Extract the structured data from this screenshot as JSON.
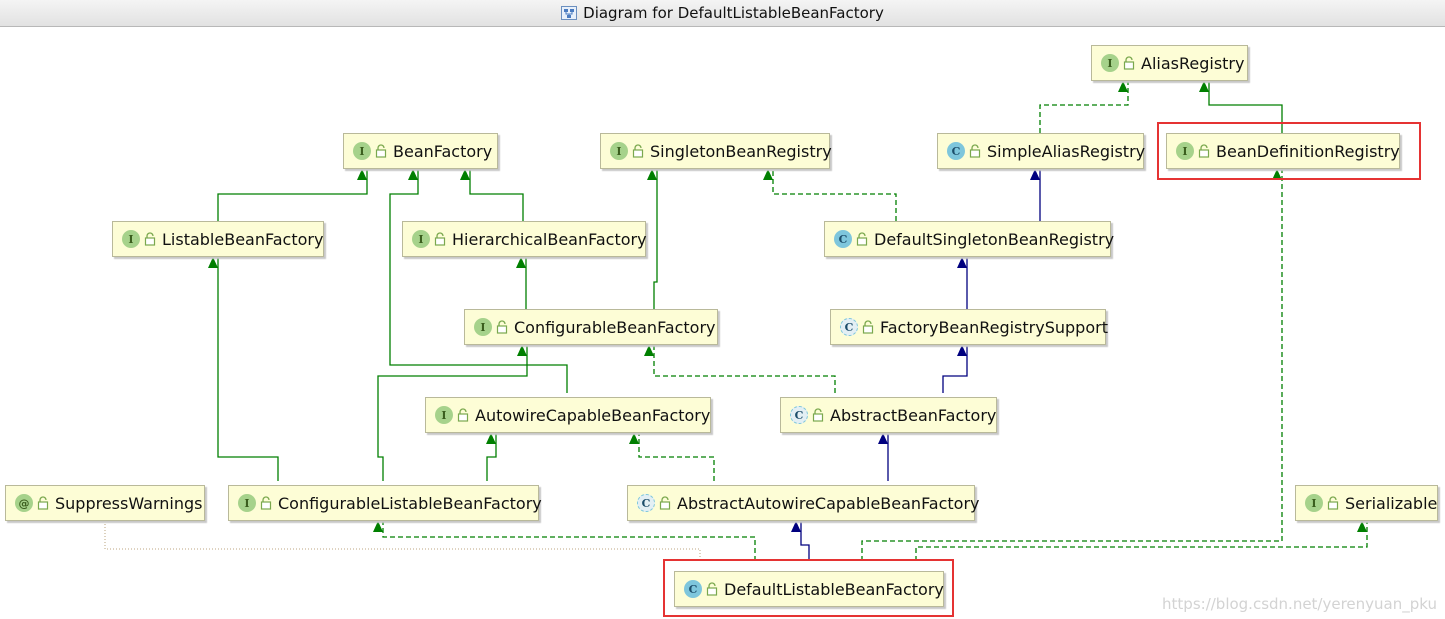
{
  "window": {
    "title": "Diagram for DefaultListableBeanFactory"
  },
  "colors": {
    "node_bg": "#fdfdd6",
    "extends_line": "#00007f",
    "implements_line": "#007f00",
    "highlight": "#e53333"
  },
  "nodes": {
    "alias_registry": {
      "badge": "I",
      "label": "AliasRegistry"
    },
    "bean_factory": {
      "badge": "I",
      "label": "BeanFactory"
    },
    "singleton_bean_registry": {
      "badge": "I",
      "label": "SingletonBeanRegistry"
    },
    "simple_alias_registry": {
      "badge": "C",
      "label": "SimpleAliasRegistry"
    },
    "bean_definition_registry": {
      "badge": "I",
      "label": "BeanDefinitionRegistry"
    },
    "listable_bean_factory": {
      "badge": "I",
      "label": "ListableBeanFactory"
    },
    "hierarchical_bean_factory": {
      "badge": "I",
      "label": "HierarchicalBeanFactory"
    },
    "default_singleton_bean_registry": {
      "badge": "C",
      "label": "DefaultSingletonBeanRegistry"
    },
    "configurable_bean_factory": {
      "badge": "I",
      "label": "ConfigurableBeanFactory"
    },
    "factory_bean_registry_support": {
      "badge": "C",
      "label": "FactoryBeanRegistrySupport"
    },
    "autowire_capable_bean_factory": {
      "badge": "I",
      "label": "AutowireCapableBeanFactory"
    },
    "abstract_bean_factory": {
      "badge": "C",
      "label": "AbstractBeanFactory"
    },
    "suppress_warnings": {
      "badge": "@",
      "label": "SuppressWarnings"
    },
    "configurable_listable_bean_factory": {
      "badge": "I",
      "label": "ConfigurableListableBeanFactory"
    },
    "abstract_autowire_capable_bean_factory": {
      "badge": "C",
      "label": "AbstractAutowireCapableBeanFactory"
    },
    "serializable": {
      "badge": "I",
      "label": "Serializable"
    },
    "default_listable_bean_factory": {
      "badge": "C",
      "label": "DefaultListableBeanFactory"
    }
  },
  "watermark": "https://blog.csdn.net/yerenyuan_pku"
}
